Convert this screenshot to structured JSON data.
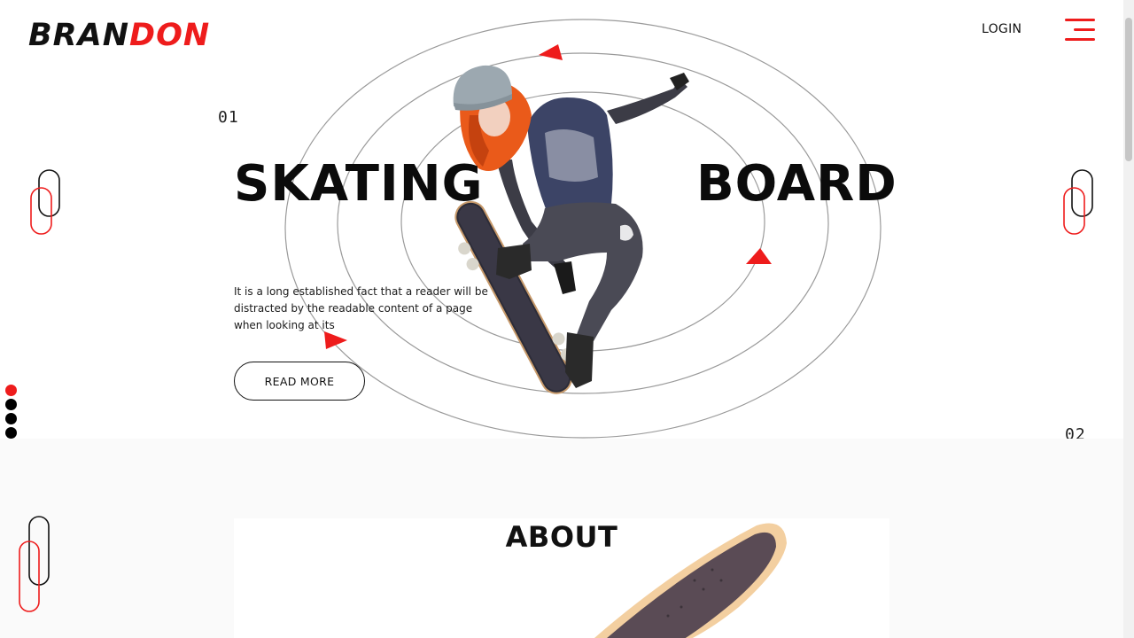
{
  "header": {
    "brand_part1": "BRAN",
    "brand_part2": "DON",
    "login_label": "LOGIN",
    "menu_icon": "hamburger-menu-icon"
  },
  "hero": {
    "slide_number": "01",
    "title_left": "SKATING",
    "title_right": "BOARD",
    "description": "It is a long established fact that a reader will be distracted by the readable content of a page when looking at its",
    "read_more_label": "READ MORE",
    "next_slide_number": "02",
    "image": "skateboarder-girl-jumping"
  },
  "slider": {
    "total_dots": 4,
    "active_index": 0
  },
  "about": {
    "title": "ABOUT",
    "image": "skateboard-deck"
  },
  "colors": {
    "accent": "#ee1c1c",
    "text": "#111111",
    "background": "#ffffff",
    "section_bg": "#fafafa"
  },
  "icons": [
    "hamburger-menu-icon",
    "paperclip-icon",
    "triangle-icon"
  ]
}
